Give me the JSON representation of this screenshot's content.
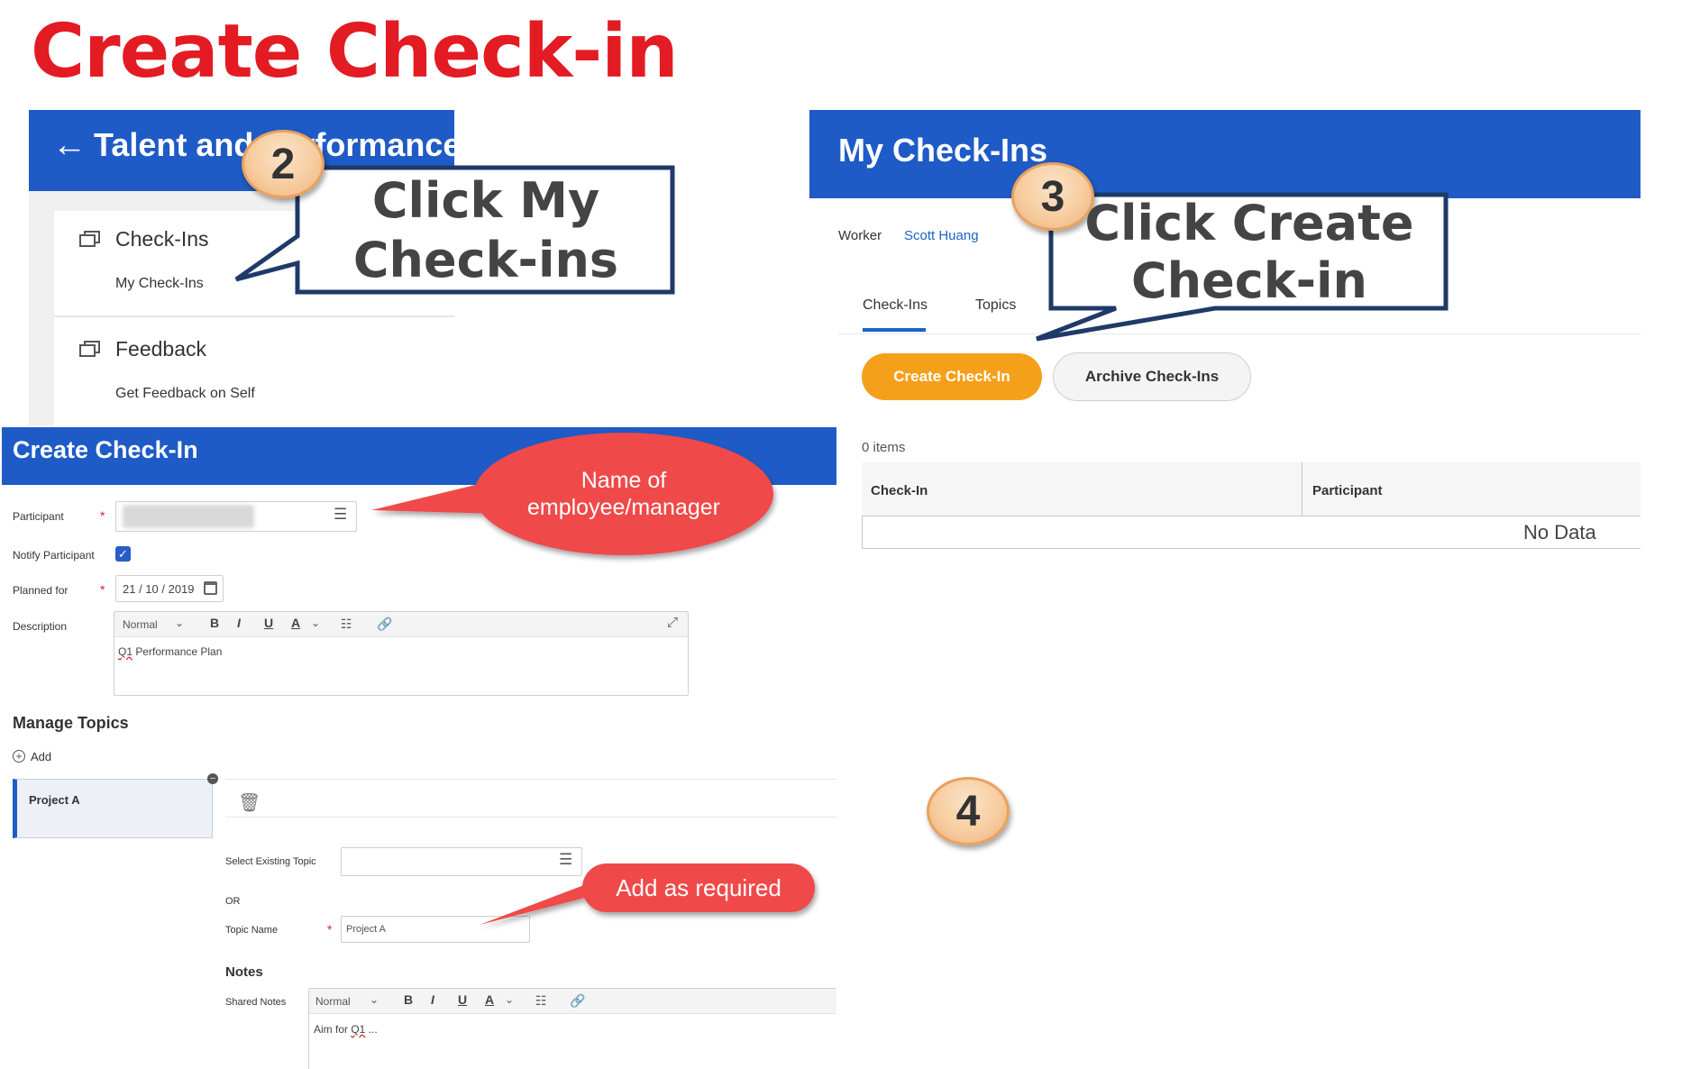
{
  "slide": {
    "title": "Create Check-in"
  },
  "talent_panel": {
    "back_arrow": "←",
    "title": "Talent and Performance",
    "sections": [
      {
        "label": "Check-Ins",
        "link": "My Check-Ins"
      },
      {
        "label": "Feedback",
        "link": "Get Feedback on Self"
      }
    ]
  },
  "my_checkins_panel": {
    "title": "My Check-Ins",
    "worker_label": "Worker",
    "worker_value": "Scott Huang",
    "tabs": [
      "Check-Ins",
      "Topics"
    ],
    "create_button": "Create Check-In",
    "archive_button": "Archive Check-Ins",
    "items_count": "0 items",
    "table_headers": [
      "Check-In",
      "Participant"
    ],
    "no_data": "No Data"
  },
  "create_form": {
    "title": "Create Check-In",
    "participant_label": "Participant",
    "notify_label": "Notify Participant",
    "planned_label": "Planned for",
    "planned_value": "21 / 10 / 2019",
    "description_label": "Description",
    "toolbar": {
      "style": "Normal",
      "bold": "B",
      "italic": "I",
      "underline": "U",
      "color": "A"
    },
    "description_text_prefix": "Q1",
    "description_text_rest": " Performance Plan",
    "manage_topics": "Manage Topics",
    "add_label": "Add",
    "topic_item": "Project A",
    "select_existing_label": "Select Existing Topic",
    "or_label": "OR",
    "topic_name_label": "Topic Name",
    "topic_name_value": "Project A",
    "notes_heading": "Notes",
    "shared_notes_label": "Shared Notes",
    "shared_notes_prefix": "Aim for ",
    "shared_notes_q": "Q1",
    "shared_notes_suffix": " ..."
  },
  "callouts": {
    "step2_number": "2",
    "step2_line1": "Click My",
    "step2_line2": "Check-ins",
    "step3_number": "3",
    "step3_line1": "Click Create",
    "step3_line2": "Check-in",
    "step4_number": "4",
    "name_note_line1": "Name of",
    "name_note_line2": "employee/manager",
    "add_note": "Add as required"
  },
  "colors": {
    "title_red": "#e31b23",
    "header_blue": "#1e5bc6",
    "create_orange": "#f5a01a",
    "callout_red": "#f04848",
    "callout_border": "#1f3a68"
  }
}
